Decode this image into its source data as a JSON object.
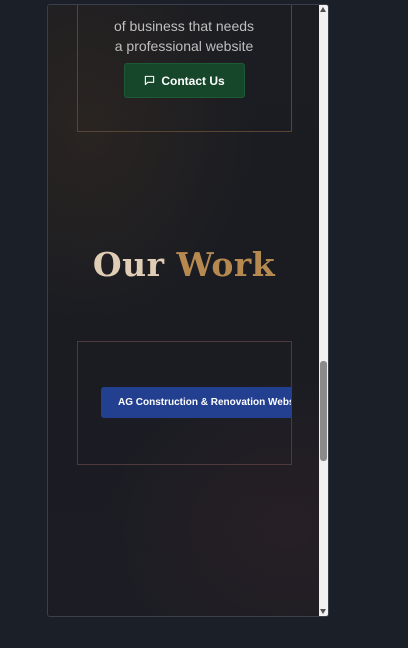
{
  "hero_card": {
    "description_line1": "of business that needs",
    "description_line2": "a professional website",
    "contact_button_label": "Contact Us",
    "contact_icon": "message-square-icon"
  },
  "work_section": {
    "title_part1": "Our",
    "title_part2": "Work",
    "project_button_label": "AG Construction & Renovation Website"
  },
  "colors": {
    "accent_gold": "#b58950",
    "contact_green": "#17472a",
    "project_blue": "#233f8f"
  }
}
